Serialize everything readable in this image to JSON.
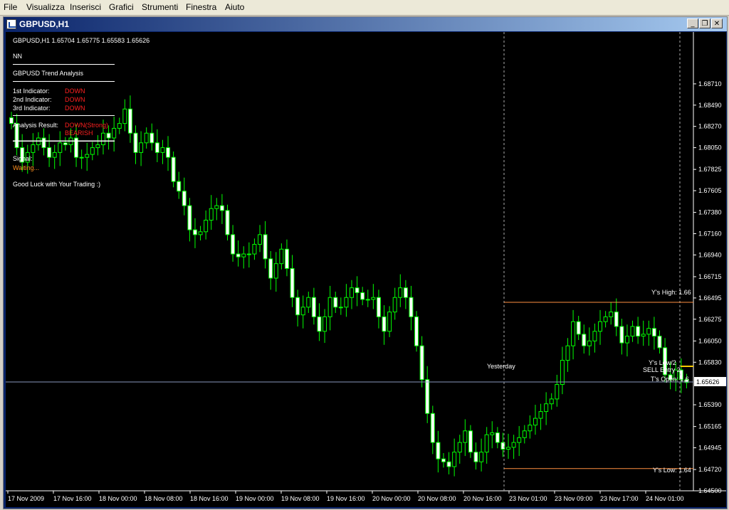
{
  "menu": [
    "File",
    "Visualizza",
    "Inserisci",
    "Grafici",
    "Strumenti",
    "Finestra",
    "Aiuto"
  ],
  "window": {
    "title": "GBPUSD,H1"
  },
  "chart_header": "GBPUSD,H1  1.65704 1.65775 1.65583 1.65626",
  "panel": {
    "name": "NN",
    "title": "GBPUSD Trend Analysis",
    "indicators": [
      {
        "label": "1st Indicator:",
        "value": "DOWN"
      },
      {
        "label": "2nd Indicator:",
        "value": "DOWN"
      },
      {
        "label": "3rd Indicator:",
        "value": "DOWN"
      }
    ],
    "result_label": "Analysis Result:",
    "result_value": "DOWN(Strong)",
    "result_bias": "BEARISH",
    "signal_label": "Signal:",
    "signal_value": "Waiting...",
    "footer": "Good Luck with Your Trading :)"
  },
  "levels": {
    "y_high": "Y's High: 1.66",
    "y_low": "Y's Low: 1.64",
    "t_open": "T's Open: 1.6",
    "yesterday": "Yesterday",
    "current_price": "1.65626",
    "ys_low_overlap": "Y's Low/2",
    "sell_overlap": "SELL Entry 2"
  },
  "colors": {
    "bull": "#00ff00",
    "bear_fill": "#ffffff",
    "level": "#ff9040",
    "grid_line": "#8899bb",
    "signal_red": "#ff2020",
    "signal_orange": "#ff9020"
  },
  "chart_data": {
    "type": "candlestick",
    "symbol": "GBPUSD",
    "timeframe": "H1",
    "ylim": [
      1.645,
      1.6893
    ],
    "y_ticks": [
      "1.68710",
      "1.68490",
      "1.68270",
      "1.68050",
      "1.67825",
      "1.67605",
      "1.67380",
      "1.67160",
      "1.66940",
      "1.66715",
      "1.66495",
      "1.66275",
      "1.66050",
      "1.65830",
      "1.65390",
      "1.65165",
      "1.64945",
      "1.64720",
      "1.64500"
    ],
    "x_ticks": [
      "17 Nov 2009",
      "17 Nov 16:00",
      "18 Nov 00:00",
      "18 Nov 08:00",
      "18 Nov 16:00",
      "19 Nov 00:00",
      "19 Nov 08:00",
      "19 Nov 16:00",
      "20 Nov 00:00",
      "20 Nov 08:00",
      "20 Nov 16:00",
      "23 Nov 01:00",
      "23 Nov 09:00",
      "23 Nov 17:00",
      "24 Nov 01:00"
    ],
    "yesterday_high": 1.6645,
    "yesterday_low": 1.6473,
    "current_price": 1.65626,
    "closes": [
      1.683,
      1.6805,
      1.679,
      1.68,
      1.6808,
      1.6815,
      1.6805,
      1.6795,
      1.68,
      1.681,
      1.6808,
      1.6815,
      1.6795,
      1.6795,
      1.6798,
      1.6805,
      1.6808,
      1.682,
      1.6815,
      1.6825,
      1.683,
      1.6845,
      1.682,
      1.68,
      1.681,
      1.682,
      1.681,
      1.68,
      1.6805,
      1.6795,
      1.677,
      1.676,
      1.6745,
      1.672,
      1.6715,
      1.6718,
      1.673,
      1.6742,
      1.6745,
      1.674,
      1.6715,
      1.6695,
      1.6692,
      1.6695,
      1.6695,
      1.6705,
      1.6715,
      1.669,
      1.667,
      1.6685,
      1.67,
      1.668,
      1.665,
      1.6632,
      1.664,
      1.665,
      1.663,
      1.6615,
      1.663,
      1.665,
      1.664,
      1.664,
      1.665,
      1.666,
      1.6655,
      1.6648,
      1.6648,
      1.665,
      1.663,
      1.6615,
      1.6635,
      1.665,
      1.666,
      1.665,
      1.663,
      1.66,
      1.6565,
      1.653,
      1.65,
      1.6483,
      1.648,
      1.6475,
      1.649,
      1.65,
      1.6512,
      1.649,
      1.648,
      1.649,
      1.6508,
      1.651,
      1.65,
      1.6493,
      1.6495,
      1.65,
      1.6505,
      1.6512,
      1.6518,
      1.6525,
      1.6532,
      1.654,
      1.6545,
      1.656,
      1.6585,
      1.66,
      1.6625,
      1.6612,
      1.66,
      1.6605,
      1.6615,
      1.6625,
      1.663,
      1.6635,
      1.662,
      1.6603,
      1.661,
      1.662,
      1.661,
      1.6612,
      1.6618,
      1.661,
      1.6598,
      1.657,
      1.6565,
      1.6575,
      1.6565,
      1.6562
    ]
  }
}
